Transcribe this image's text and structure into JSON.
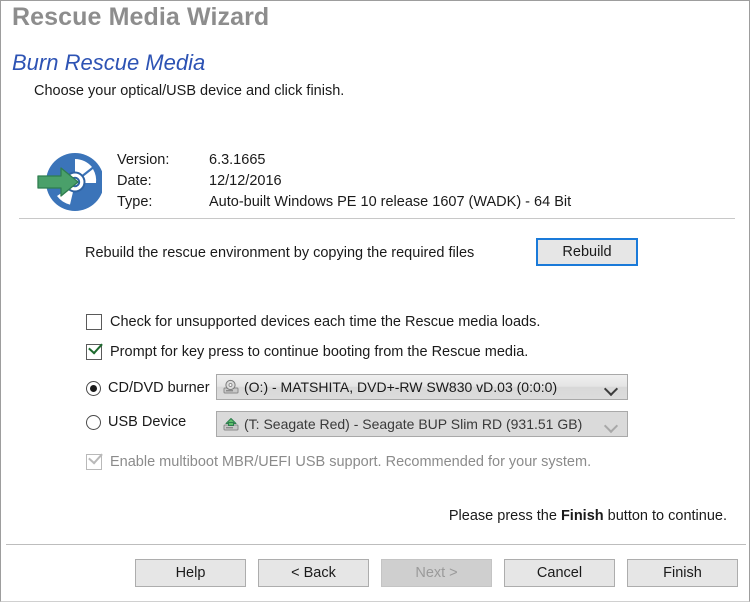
{
  "window": {
    "app_title": "Rescue Media Wizard",
    "page_heading": "Burn Rescue Media",
    "page_subheading": "Choose your optical/USB device and click finish."
  },
  "info": {
    "icon": "rescue-disc-icon",
    "rows": [
      {
        "label": "Version:",
        "value": "6.3.1665"
      },
      {
        "label": "Date:",
        "value": "12/12/2016"
      },
      {
        "label": "Type:",
        "value": "Auto-built Windows PE 10 release 1607 (WADK) - 64 Bit"
      }
    ]
  },
  "rebuild": {
    "description": "Rebuild the rescue environment by copying the required files",
    "button_label": "Rebuild"
  },
  "options": {
    "check_unsupported": {
      "label": "Check for unsupported devices each time the Rescue media loads.",
      "checked": false
    },
    "prompt_key_press": {
      "label": "Prompt for key press to continue booting from the Rescue media.",
      "checked": true
    },
    "multiboot": {
      "label": "Enable multiboot MBR/UEFI USB support. Recommended for your system.",
      "checked": true,
      "disabled": true
    }
  },
  "targets": {
    "cd": {
      "radio_label": "CD/DVD burner",
      "selected": true,
      "device_icon": "optical-drive-icon",
      "device_value": "(O:) - MATSHITA, DVD+-RW SW830   vD.03 (0:0:0)"
    },
    "usb": {
      "radio_label": "USB Device",
      "selected": false,
      "device_icon": "usb-drive-icon",
      "device_value": "(T: Seagate Red) - Seagate BUP Slim RD (931.51 GB)"
    }
  },
  "hint": {
    "before": "Please press the",
    "strong": "Finish",
    "after": "button to continue."
  },
  "footer": {
    "buttons": [
      {
        "label": "Help",
        "disabled": false
      },
      {
        "label": "< Back",
        "disabled": false
      },
      {
        "label": "Next >",
        "disabled": true
      },
      {
        "label": "Cancel",
        "disabled": false
      },
      {
        "label": "Finish",
        "disabled": false
      }
    ]
  },
  "colors": {
    "heading_blue": "#2d53b4",
    "title_grey": "#8d8d8d",
    "focus_blue": "#1a7ad9",
    "disc_blue": "#3b74b9",
    "arrow_green": "#4aa06a"
  }
}
